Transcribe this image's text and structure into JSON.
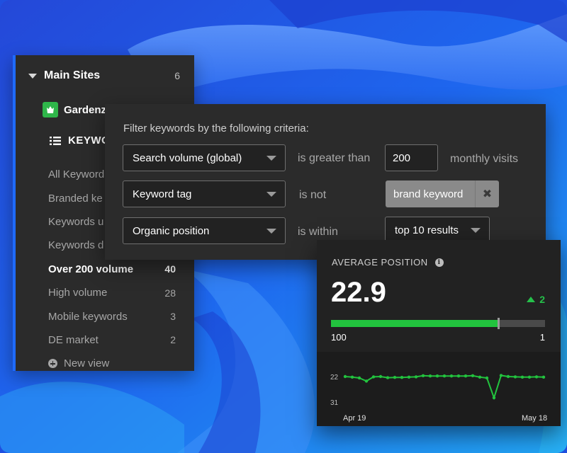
{
  "sidebar": {
    "group_title": "Main Sites",
    "group_count": "6",
    "site_name": "Gardenz",
    "section_label": "KEYWO",
    "views": [
      {
        "label": "All Keyword",
        "count": ""
      },
      {
        "label": "Branded ke",
        "count": ""
      },
      {
        "label": "Keywords u",
        "count": ""
      },
      {
        "label": "Keywords d",
        "count": ""
      },
      {
        "label": "Over 200 volume",
        "count": "40"
      },
      {
        "label": "High volume",
        "count": "28"
      },
      {
        "label": "Mobile keywords",
        "count": "3"
      },
      {
        "label": "DE market",
        "count": "2"
      }
    ],
    "active_view_index": 4,
    "new_view_label": "New view"
  },
  "filter": {
    "title": "Filter keywords by the following criteria:",
    "rows": [
      {
        "field": "Search volume (global)",
        "operator": "is greater than",
        "value": "200",
        "unit": "monthly visits"
      },
      {
        "field": "Keyword tag",
        "operator": "is not",
        "tag": "brand keyword"
      },
      {
        "field": "Organic position",
        "operator": "is within",
        "value_select": "top 10 results"
      }
    ]
  },
  "stats": {
    "label": "AVERAGE POSITION",
    "value": "22.9",
    "delta": "2",
    "range_min": "100",
    "range_max": "1",
    "progress_fraction": 0.78
  },
  "chart_data": {
    "type": "line",
    "x_labels": [
      "Apr 19",
      "May 18"
    ],
    "y_ticks": [
      "22",
      "31"
    ],
    "ylim": [
      22,
      31
    ],
    "y_inverted": true,
    "series": [
      {
        "values": [
          22.0,
          22.2,
          22.5,
          23.6,
          22.1,
          22.0,
          22.4,
          22.3,
          22.3,
          22.2,
          22.1,
          21.7,
          21.8,
          21.8,
          21.8,
          21.8,
          21.8,
          21.8,
          21.7,
          22.2,
          22.5,
          29.5,
          21.6,
          22.0,
          22.1,
          22.2,
          22.2,
          22.1,
          22.2
        ]
      }
    ],
    "colors": {
      "line": "#22c33e"
    }
  },
  "colors": {
    "accent_blue": "#1f6bff",
    "positive_green": "#25c04a"
  },
  "icons": {
    "caret": "chevron-down-icon",
    "list": "list-icon",
    "info": "info-icon",
    "close": "close-icon",
    "plus": "plus-circle-icon",
    "trend_up": "trend-up-icon"
  }
}
